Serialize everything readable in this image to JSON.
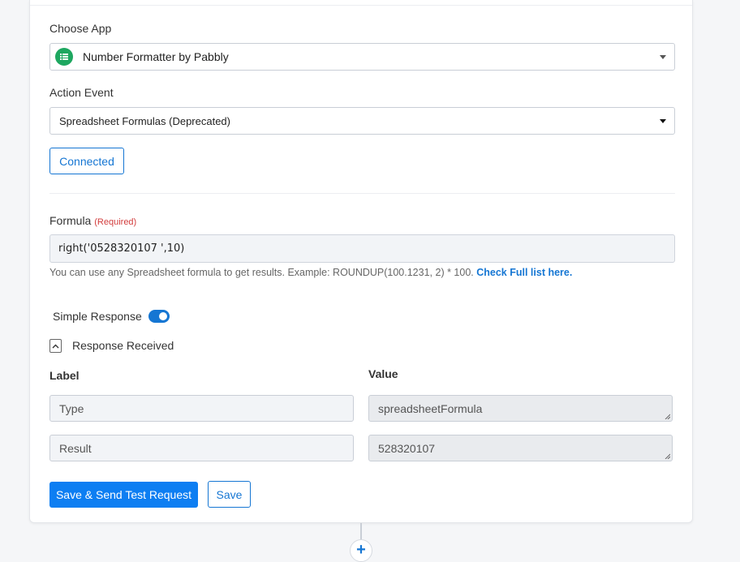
{
  "choose_app": {
    "label": "Choose App",
    "selected": "Number Formatter by Pabbly",
    "icon": "list-formatter-icon",
    "icon_color": "#1ea760"
  },
  "action_event": {
    "label": "Action Event",
    "selected": "Spreadsheet Formulas (Deprecated)"
  },
  "connection": {
    "button_label": "Connected"
  },
  "formula": {
    "label": "Formula",
    "required_tag": "(Required)",
    "value": "right('0528320107 ',10)",
    "help_text": "You can use any Spreadsheet formula to get results. Example: ROUNDUP(100.1231, 2) * 100.",
    "help_link": "Check Full list here."
  },
  "simple_response": {
    "label": "Simple Response",
    "enabled": true
  },
  "response_received": {
    "label": "Response Received",
    "columns": {
      "label": "Label",
      "value": "Value"
    },
    "rows": [
      {
        "label": "Type",
        "value": "spreadsheetFormula"
      },
      {
        "label": "Result",
        "value": "528320107"
      }
    ]
  },
  "actions": {
    "primary_label": "Save & Send Test Request",
    "secondary_label": "Save"
  },
  "colors": {
    "accent": "#1576d3",
    "primary_button": "#0d7ef2",
    "required": "#d23c3c"
  }
}
